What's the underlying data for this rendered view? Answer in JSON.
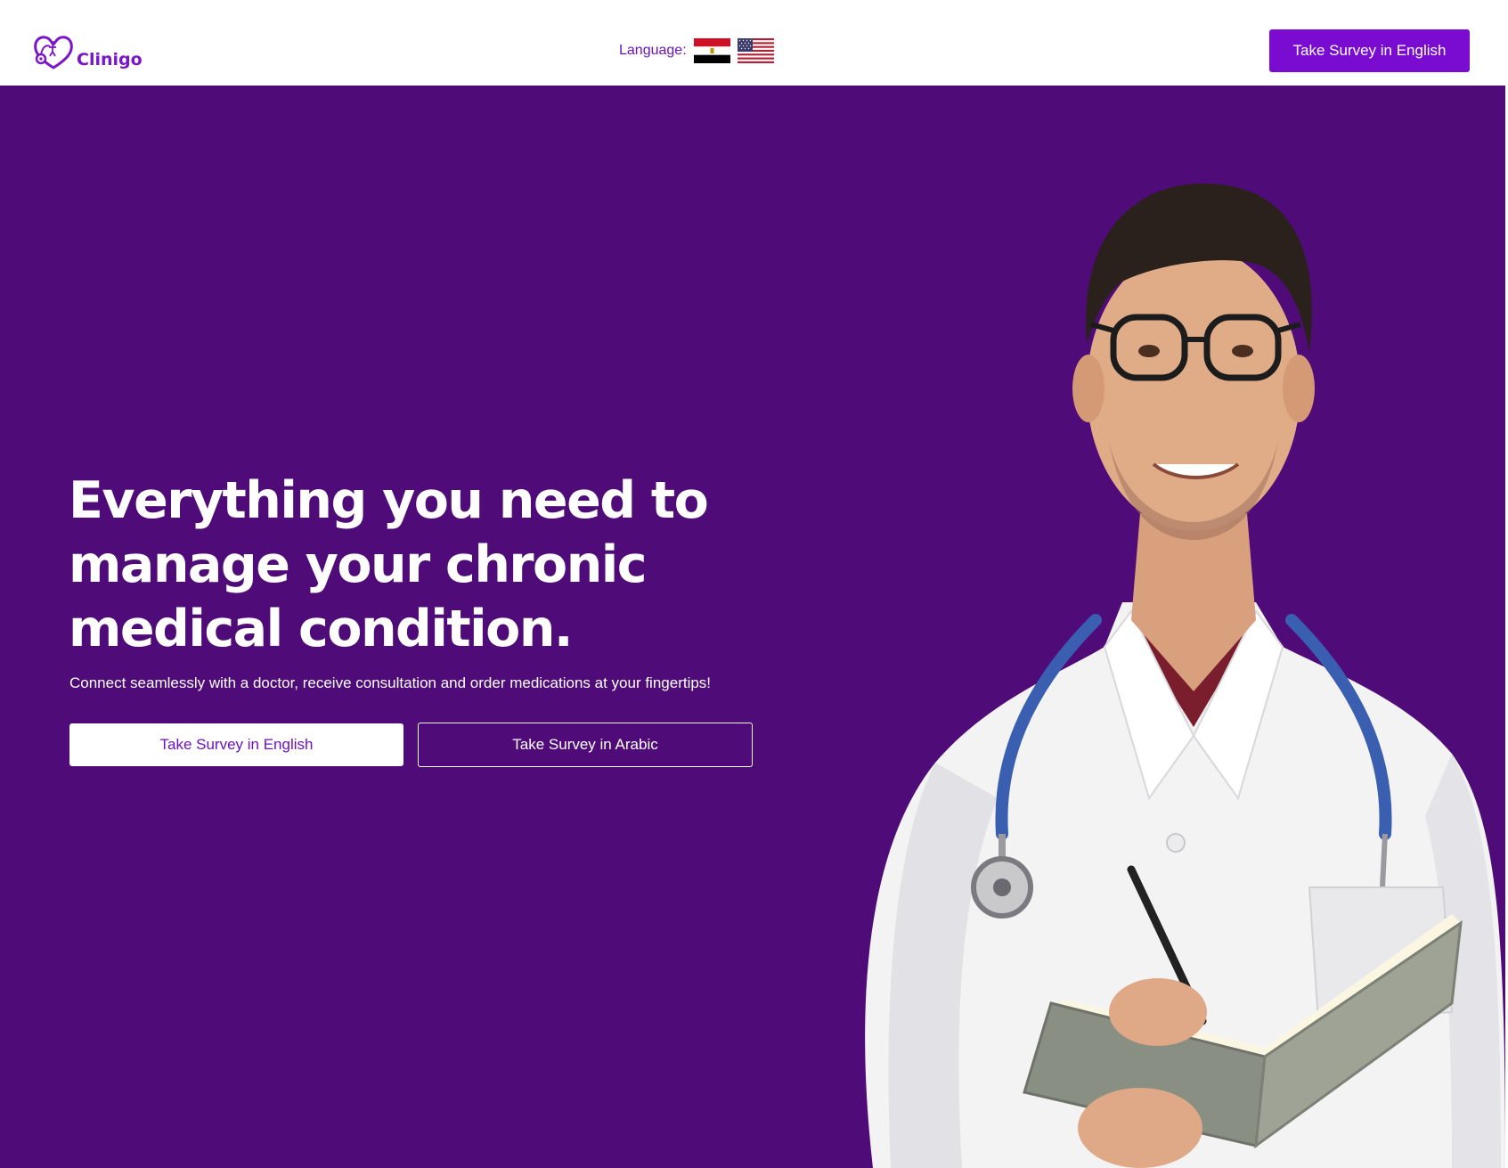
{
  "brand": {
    "name": "Clinigo",
    "color": "#7b15c8"
  },
  "header": {
    "language_label": "Language:",
    "flags": [
      "egypt-flag-icon",
      "us-flag-icon"
    ],
    "cta_label": "Take Survey in English"
  },
  "hero": {
    "headline_lines": [
      "Everything you need to",
      "manage your chronic",
      "medical condition."
    ],
    "subtext": "Connect seamlessly with a doctor, receive consultation and order medications at your fingertips!",
    "btn_english": "Take Survey in English",
    "btn_arabic": "Take Survey in Arabic",
    "background_color": "#4f0c78",
    "image": "doctor-with-stethoscope-and-notebook"
  },
  "colors": {
    "accent": "#7a0bd0",
    "hero_bg": "#4f0c78",
    "white": "#ffffff"
  }
}
